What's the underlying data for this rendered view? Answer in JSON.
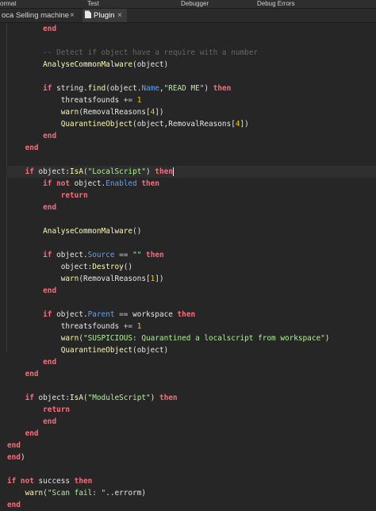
{
  "menubar": {
    "items": [
      "ormat",
      "Test",
      "Debugger",
      "Debug Errors"
    ]
  },
  "tabs": [
    {
      "label": "oca Selling machine",
      "active": false
    },
    {
      "label": "Plugin",
      "active": true
    }
  ],
  "close_glyph": "×",
  "code": {
    "current_line": 12,
    "lines": [
      [
        [
          "        ",
          ""
        ],
        [
          "end",
          "kw"
        ]
      ],
      [
        [
          "",
          ""
        ]
      ],
      [
        [
          "        ",
          ""
        ],
        [
          "-- Detect if object have a require with a number",
          "cmt"
        ]
      ],
      [
        [
          "        ",
          ""
        ],
        [
          "AnalyseCommonMalware",
          "fn"
        ],
        [
          "(object)",
          ""
        ]
      ],
      [
        [
          "",
          ""
        ]
      ],
      [
        [
          "        ",
          ""
        ],
        [
          "if ",
          "kw"
        ],
        [
          "string",
          ""
        ],
        [
          ".",
          ""
        ],
        [
          "find",
          "fn"
        ],
        [
          "(object.",
          ""
        ],
        [
          "Name",
          "prop"
        ],
        [
          ",",
          ""
        ],
        [
          "\"READ ME\"",
          "str"
        ],
        [
          ") ",
          ""
        ],
        [
          "then",
          "kw"
        ]
      ],
      [
        [
          "            threatsfounds ",
          ""
        ],
        [
          "+=",
          "op"
        ],
        [
          " ",
          ""
        ],
        [
          "1",
          "num"
        ]
      ],
      [
        [
          "            ",
          ""
        ],
        [
          "warn",
          "fn"
        ],
        [
          "(RemovalReasons[",
          ""
        ],
        [
          "4",
          "num"
        ],
        [
          "])",
          ""
        ]
      ],
      [
        [
          "            ",
          ""
        ],
        [
          "QuarantineObject",
          "fn"
        ],
        [
          "(object,RemovalReasons[",
          ""
        ],
        [
          "4",
          "num"
        ],
        [
          "])",
          ""
        ]
      ],
      [
        [
          "        ",
          ""
        ],
        [
          "end",
          "kw"
        ]
      ],
      [
        [
          "    ",
          ""
        ],
        [
          "end",
          "kw"
        ]
      ],
      [
        [
          "",
          ""
        ]
      ],
      [
        [
          "    ",
          ""
        ],
        [
          "if ",
          "kw"
        ],
        [
          "object:",
          ""
        ],
        [
          "IsA",
          "fn"
        ],
        [
          "(",
          ""
        ],
        [
          "\"LocalScript\"",
          "str"
        ],
        [
          ") ",
          ""
        ],
        [
          "then",
          "kw"
        ]
      ],
      [
        [
          "        ",
          ""
        ],
        [
          "if not ",
          "kw"
        ],
        [
          "object.",
          ""
        ],
        [
          "Enabled",
          "prop"
        ],
        [
          " ",
          ""
        ],
        [
          "then",
          "kw"
        ]
      ],
      [
        [
          "            ",
          ""
        ],
        [
          "return",
          "kw"
        ]
      ],
      [
        [
          "        ",
          ""
        ],
        [
          "end",
          "kw"
        ]
      ],
      [
        [
          "",
          ""
        ]
      ],
      [
        [
          "        ",
          ""
        ],
        [
          "AnalyseCommonMalware",
          "fn"
        ],
        [
          "()",
          ""
        ]
      ],
      [
        [
          "",
          ""
        ]
      ],
      [
        [
          "        ",
          ""
        ],
        [
          "if ",
          "kw"
        ],
        [
          "object.",
          ""
        ],
        [
          "Source",
          "prop"
        ],
        [
          " ",
          ""
        ],
        [
          "==",
          "op"
        ],
        [
          " ",
          ""
        ],
        [
          "\"\"",
          "str"
        ],
        [
          " ",
          ""
        ],
        [
          "then",
          "kw"
        ]
      ],
      [
        [
          "            object:",
          ""
        ],
        [
          "Destroy",
          "fn"
        ],
        [
          "()",
          ""
        ]
      ],
      [
        [
          "            ",
          ""
        ],
        [
          "warn",
          "fn"
        ],
        [
          "(RemovalReasons[",
          ""
        ],
        [
          "1",
          "num"
        ],
        [
          "])",
          ""
        ]
      ],
      [
        [
          "        ",
          ""
        ],
        [
          "end",
          "kw"
        ]
      ],
      [
        [
          "",
          ""
        ]
      ],
      [
        [
          "        ",
          ""
        ],
        [
          "if ",
          "kw"
        ],
        [
          "object.",
          ""
        ],
        [
          "Parent",
          "prop"
        ],
        [
          " ",
          ""
        ],
        [
          "==",
          "op"
        ],
        [
          " workspace ",
          ""
        ],
        [
          "then",
          "kw"
        ]
      ],
      [
        [
          "            threatsfounds ",
          ""
        ],
        [
          "+=",
          "op"
        ],
        [
          " ",
          ""
        ],
        [
          "1",
          "num"
        ]
      ],
      [
        [
          "            ",
          ""
        ],
        [
          "warn",
          "fn"
        ],
        [
          "(",
          ""
        ],
        [
          "\"SUSPICIOUS: Quarantined a localscript from workspace\"",
          "str"
        ],
        [
          ")",
          ""
        ]
      ],
      [
        [
          "            ",
          ""
        ],
        [
          "QuarantineObject",
          "fn"
        ],
        [
          "(object)",
          ""
        ]
      ],
      [
        [
          "        ",
          ""
        ],
        [
          "end",
          "kw"
        ]
      ],
      [
        [
          "    ",
          ""
        ],
        [
          "end",
          "kw"
        ]
      ],
      [
        [
          "",
          ""
        ]
      ],
      [
        [
          "    ",
          ""
        ],
        [
          "if ",
          "kw"
        ],
        [
          "object:",
          ""
        ],
        [
          "IsA",
          "fn"
        ],
        [
          "(",
          ""
        ],
        [
          "\"ModuleScript\"",
          "str"
        ],
        [
          ") ",
          ""
        ],
        [
          "then",
          "kw"
        ]
      ],
      [
        [
          "        ",
          ""
        ],
        [
          "return",
          "kw"
        ]
      ],
      [
        [
          "        ",
          ""
        ],
        [
          "end",
          "kw"
        ]
      ],
      [
        [
          "    ",
          ""
        ],
        [
          "end",
          "kw"
        ]
      ],
      [
        [
          "",
          ""
        ],
        [
          "end",
          "kw"
        ]
      ],
      [
        [
          "",
          ""
        ],
        [
          "end",
          "kw"
        ],
        [
          ")",
          ""
        ]
      ],
      [
        [
          "",
          ""
        ]
      ],
      [
        [
          "",
          ""
        ],
        [
          "if not ",
          "kw"
        ],
        [
          "success ",
          ""
        ],
        [
          "then",
          "kw"
        ]
      ],
      [
        [
          "    ",
          ""
        ],
        [
          "warn",
          "fn"
        ],
        [
          "(",
          ""
        ],
        [
          "\"Scan fail: \"",
          "str"
        ],
        [
          "..errorm)",
          ""
        ]
      ],
      [
        [
          "",
          ""
        ],
        [
          "end",
          "kw"
        ]
      ]
    ]
  }
}
